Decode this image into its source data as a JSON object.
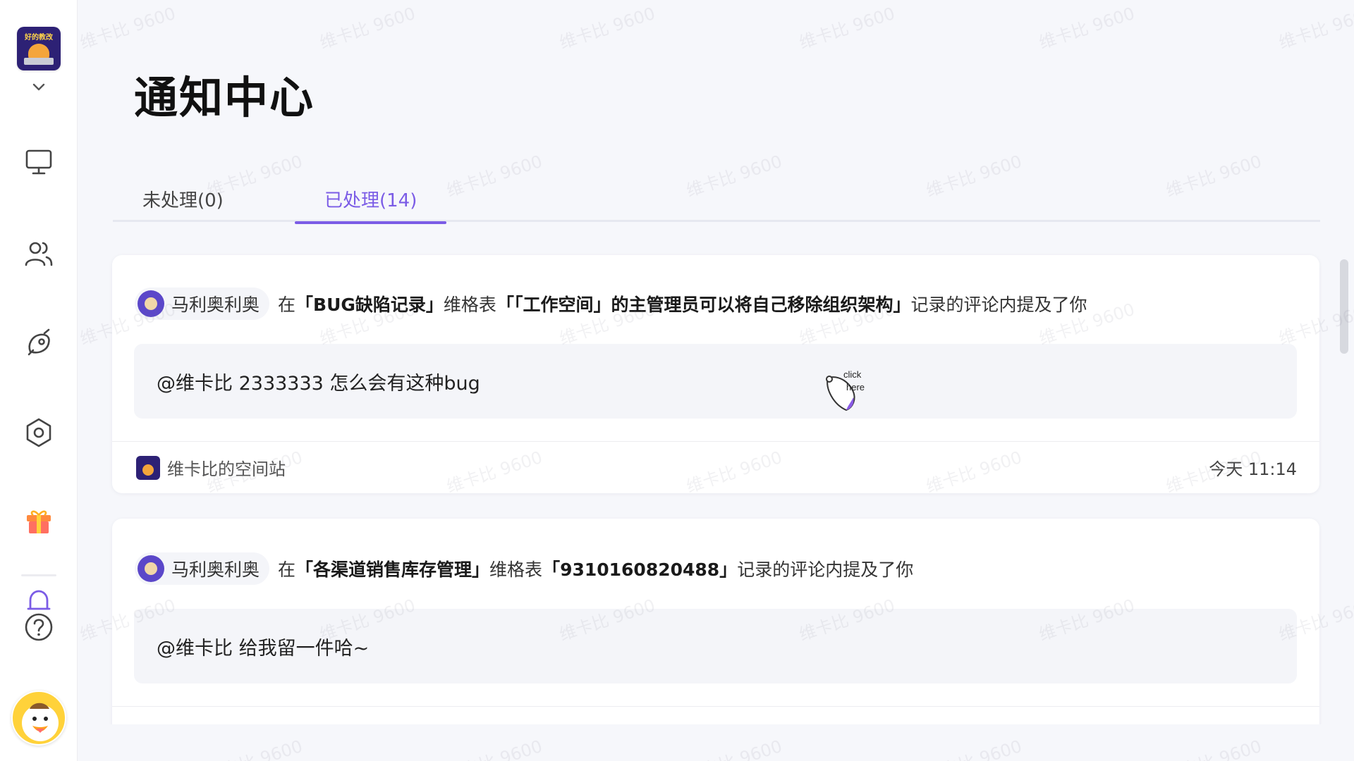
{
  "app": {
    "title": "通知中心",
    "watermark_text": "维卡比 9600"
  },
  "sidebar": {
    "space_logo_text": "好的教改",
    "icons": [
      "monitor-icon",
      "users-icon",
      "rocket-icon",
      "settings-hexagon-icon",
      "gift-icon",
      "bell-icon",
      "help-icon"
    ]
  },
  "tabs": [
    {
      "label": "未处理(0)",
      "active": false
    },
    {
      "label": "已处理(14)",
      "active": true
    }
  ],
  "notifications": [
    {
      "user": "马利奥利奥",
      "prefix": "在",
      "table": "「BUG缺陷记录」",
      "mid": "维格表",
      "record": "「「工作空间」的主管理员可以将自己移除组织架构」",
      "suffix": "记录的评论内提及了你",
      "comment": "@维卡比 2333333 怎么会有这种bug",
      "space": "维卡比的空间站",
      "time": "今天 11:14"
    },
    {
      "user": "马利奥利奥",
      "prefix": "在",
      "table": "「各渠道销售库存管理」",
      "mid": "维格表",
      "record": "「9310160820488」",
      "suffix": "记录的评论内提及了你",
      "comment": "@维卡比  给我留一件哈~"
    }
  ],
  "overlay": {
    "click_here_text_1": "click",
    "click_here_text_2": "here"
  },
  "colors": {
    "accent": "#7b5ce6",
    "background": "#f6f7fb",
    "card": "#ffffff",
    "comment_bg": "#f4f5f9"
  }
}
